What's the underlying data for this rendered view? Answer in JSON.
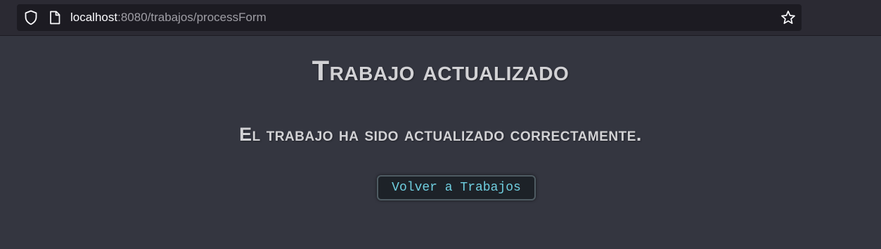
{
  "browser": {
    "url_host": "localhost",
    "url_rest": ":8080/trabajos/processForm",
    "icons": [
      "shield-icon",
      "page-icon",
      "star-icon"
    ]
  },
  "main": {
    "title": "Trabajo actualizado",
    "message": "El trabajo ha sido actualizado correctamente.",
    "back_button_label": "Volver a Trabajos"
  },
  "colors": {
    "page_background": "#343640",
    "heading_text": "#d2d2d5",
    "button_text": "#6fcfe0",
    "button_background": "#1d2228"
  }
}
